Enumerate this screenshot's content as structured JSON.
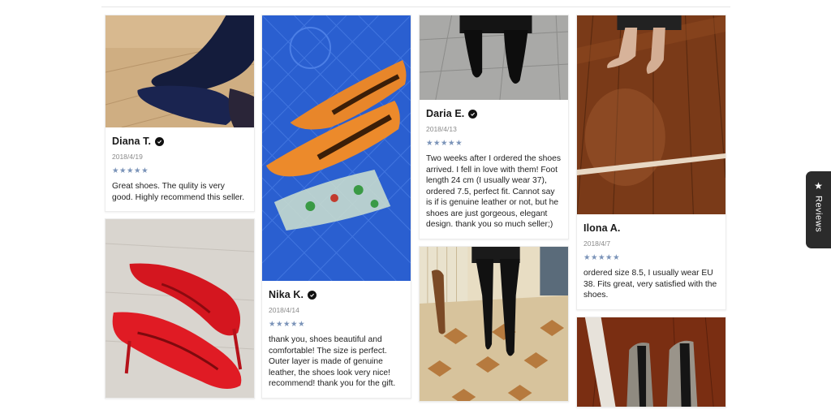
{
  "reviews_tab": {
    "label": "Reviews",
    "icon": "star-icon"
  },
  "rating_stars": "★★★★★",
  "reviews": [
    {
      "name": "Diana T.",
      "date": "2018/4/19",
      "rating": 5,
      "text": "Great shoes. The qulity is very good. Highly recommend this seller."
    },
    {
      "name": "Nika K.",
      "date": "2018/4/14",
      "rating": 5,
      "text": "thank you, shoes beautiful and comfortable! The size is perfect. Outer layer is made of genuine leather, the shoes look very nice! recommend! thank you for the gift."
    },
    {
      "name": "Daria E.",
      "date": "2018/4/13",
      "rating": 5,
      "text": "Two weeks after I ordered the shoes arrived. I fell in love with them! Foot length 24 cm (I usually wear 37), ordered 7.5, perfect fit. Cannot say is if is genuine leather or not, but he shoes are just gorgeous, elegant design. thank you so much seller;)"
    },
    {
      "name": "Ilona A.",
      "date": "2018/4/7",
      "rating": 5,
      "text": "ordered size 8.5, I usually wear EU 38. Fits great, very satisfied with the shoes."
    }
  ],
  "colors": {
    "stars": "#7a93b8",
    "tab_bg": "#2b2b2b"
  }
}
